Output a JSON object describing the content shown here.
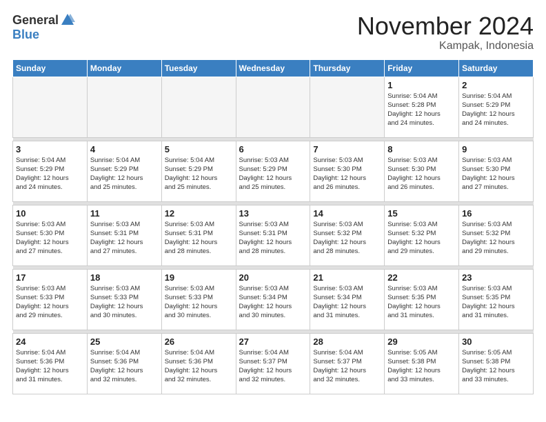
{
  "header": {
    "logo_general": "General",
    "logo_blue": "Blue",
    "month_title": "November 2024",
    "location": "Kampak, Indonesia"
  },
  "weekdays": [
    "Sunday",
    "Monday",
    "Tuesday",
    "Wednesday",
    "Thursday",
    "Friday",
    "Saturday"
  ],
  "weeks": [
    [
      {
        "day": "",
        "info": ""
      },
      {
        "day": "",
        "info": ""
      },
      {
        "day": "",
        "info": ""
      },
      {
        "day": "",
        "info": ""
      },
      {
        "day": "",
        "info": ""
      },
      {
        "day": "1",
        "info": "Sunrise: 5:04 AM\nSunset: 5:28 PM\nDaylight: 12 hours\nand 24 minutes."
      },
      {
        "day": "2",
        "info": "Sunrise: 5:04 AM\nSunset: 5:29 PM\nDaylight: 12 hours\nand 24 minutes."
      }
    ],
    [
      {
        "day": "3",
        "info": "Sunrise: 5:04 AM\nSunset: 5:29 PM\nDaylight: 12 hours\nand 24 minutes."
      },
      {
        "day": "4",
        "info": "Sunrise: 5:04 AM\nSunset: 5:29 PM\nDaylight: 12 hours\nand 25 minutes."
      },
      {
        "day": "5",
        "info": "Sunrise: 5:04 AM\nSunset: 5:29 PM\nDaylight: 12 hours\nand 25 minutes."
      },
      {
        "day": "6",
        "info": "Sunrise: 5:03 AM\nSunset: 5:29 PM\nDaylight: 12 hours\nand 25 minutes."
      },
      {
        "day": "7",
        "info": "Sunrise: 5:03 AM\nSunset: 5:30 PM\nDaylight: 12 hours\nand 26 minutes."
      },
      {
        "day": "8",
        "info": "Sunrise: 5:03 AM\nSunset: 5:30 PM\nDaylight: 12 hours\nand 26 minutes."
      },
      {
        "day": "9",
        "info": "Sunrise: 5:03 AM\nSunset: 5:30 PM\nDaylight: 12 hours\nand 27 minutes."
      }
    ],
    [
      {
        "day": "10",
        "info": "Sunrise: 5:03 AM\nSunset: 5:30 PM\nDaylight: 12 hours\nand 27 minutes."
      },
      {
        "day": "11",
        "info": "Sunrise: 5:03 AM\nSunset: 5:31 PM\nDaylight: 12 hours\nand 27 minutes."
      },
      {
        "day": "12",
        "info": "Sunrise: 5:03 AM\nSunset: 5:31 PM\nDaylight: 12 hours\nand 28 minutes."
      },
      {
        "day": "13",
        "info": "Sunrise: 5:03 AM\nSunset: 5:31 PM\nDaylight: 12 hours\nand 28 minutes."
      },
      {
        "day": "14",
        "info": "Sunrise: 5:03 AM\nSunset: 5:32 PM\nDaylight: 12 hours\nand 28 minutes."
      },
      {
        "day": "15",
        "info": "Sunrise: 5:03 AM\nSunset: 5:32 PM\nDaylight: 12 hours\nand 29 minutes."
      },
      {
        "day": "16",
        "info": "Sunrise: 5:03 AM\nSunset: 5:32 PM\nDaylight: 12 hours\nand 29 minutes."
      }
    ],
    [
      {
        "day": "17",
        "info": "Sunrise: 5:03 AM\nSunset: 5:33 PM\nDaylight: 12 hours\nand 29 minutes."
      },
      {
        "day": "18",
        "info": "Sunrise: 5:03 AM\nSunset: 5:33 PM\nDaylight: 12 hours\nand 30 minutes."
      },
      {
        "day": "19",
        "info": "Sunrise: 5:03 AM\nSunset: 5:33 PM\nDaylight: 12 hours\nand 30 minutes."
      },
      {
        "day": "20",
        "info": "Sunrise: 5:03 AM\nSunset: 5:34 PM\nDaylight: 12 hours\nand 30 minutes."
      },
      {
        "day": "21",
        "info": "Sunrise: 5:03 AM\nSunset: 5:34 PM\nDaylight: 12 hours\nand 31 minutes."
      },
      {
        "day": "22",
        "info": "Sunrise: 5:03 AM\nSunset: 5:35 PM\nDaylight: 12 hours\nand 31 minutes."
      },
      {
        "day": "23",
        "info": "Sunrise: 5:03 AM\nSunset: 5:35 PM\nDaylight: 12 hours\nand 31 minutes."
      }
    ],
    [
      {
        "day": "24",
        "info": "Sunrise: 5:04 AM\nSunset: 5:36 PM\nDaylight: 12 hours\nand 31 minutes."
      },
      {
        "day": "25",
        "info": "Sunrise: 5:04 AM\nSunset: 5:36 PM\nDaylight: 12 hours\nand 32 minutes."
      },
      {
        "day": "26",
        "info": "Sunrise: 5:04 AM\nSunset: 5:36 PM\nDaylight: 12 hours\nand 32 minutes."
      },
      {
        "day": "27",
        "info": "Sunrise: 5:04 AM\nSunset: 5:37 PM\nDaylight: 12 hours\nand 32 minutes."
      },
      {
        "day": "28",
        "info": "Sunrise: 5:04 AM\nSunset: 5:37 PM\nDaylight: 12 hours\nand 32 minutes."
      },
      {
        "day": "29",
        "info": "Sunrise: 5:05 AM\nSunset: 5:38 PM\nDaylight: 12 hours\nand 33 minutes."
      },
      {
        "day": "30",
        "info": "Sunrise: 5:05 AM\nSunset: 5:38 PM\nDaylight: 12 hours\nand 33 minutes."
      }
    ]
  ]
}
